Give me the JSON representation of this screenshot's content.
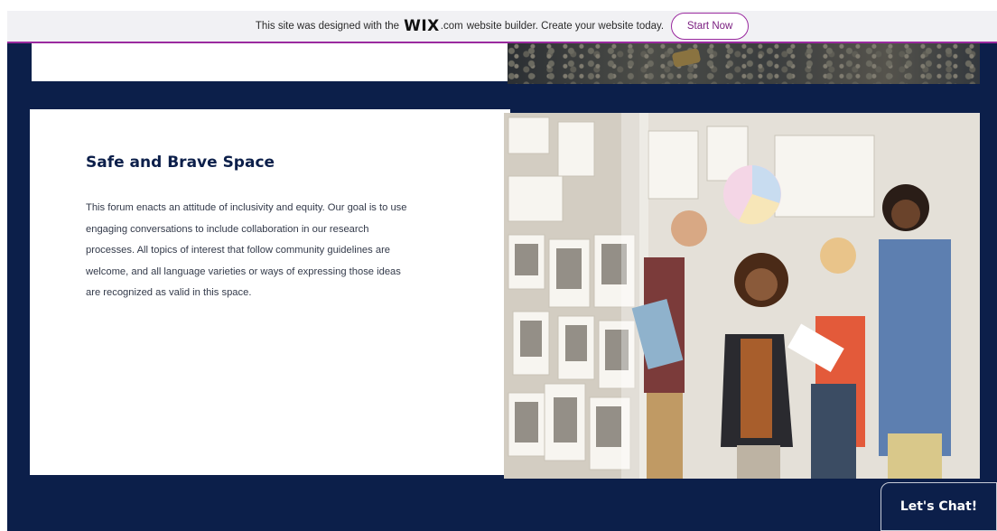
{
  "banner": {
    "text_before": "This site was designed with the",
    "logo": "WIX",
    "logo_suffix": ".com",
    "text_after": "website builder. Create your website today.",
    "button_label": "Start Now"
  },
  "section": {
    "title": "Safe and Brave Space",
    "body": "This forum enacts an attitude of inclusivity and equity. Our goal is to use engaging conversations to include collaboration in our research processes. All topics of interest that follow community guidelines are welcome, and all language varieties or ways of expressing those ideas are recognized as valid in this space."
  },
  "chat": {
    "label": "Let's Chat!"
  },
  "colors": {
    "navy": "#0c1f4a",
    "banner_bg": "#f1f1f4",
    "accent_purple": "#9a2a9f"
  }
}
